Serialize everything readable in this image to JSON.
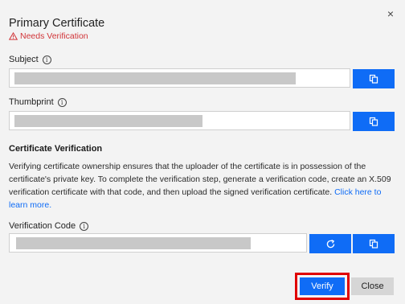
{
  "dialog": {
    "title": "Primary Certificate",
    "status": "Needs Verification",
    "close_glyph": "×"
  },
  "subject": {
    "label": "Subject",
    "value": "",
    "copy_icon": "copy-icon"
  },
  "thumbprint": {
    "label": "Thumbprint",
    "value": "",
    "copy_icon": "copy-icon"
  },
  "verification": {
    "heading": "Certificate Verification",
    "description": "Verifying certificate ownership ensures that the uploader of the certificate is in possession of the certificate's private key. To complete the verification step, generate a verification code, create an X.509 verification certificate with that code, and then upload the signed verification certificate.",
    "link": "Click here to learn more."
  },
  "verification_code": {
    "label": "Verification Code",
    "value": "",
    "refresh_icon": "refresh-icon",
    "copy_icon": "copy-icon"
  },
  "actions": {
    "verify": "Verify",
    "close": "Close"
  },
  "colors": {
    "accent": "#0f6cf6",
    "warning": "#d13438",
    "highlight": "#e00000"
  }
}
